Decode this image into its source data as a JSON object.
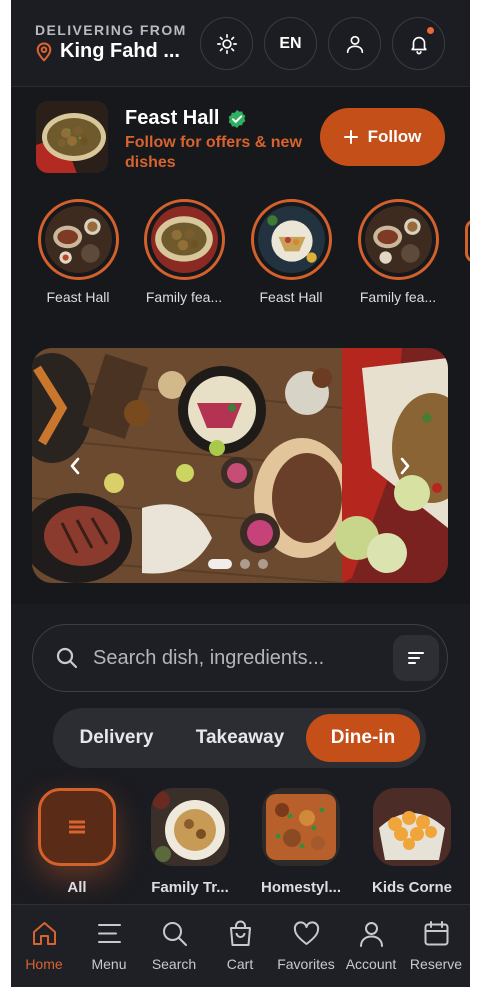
{
  "header": {
    "delivering_label": "DELIVERING FROM",
    "location": "King Fahd ...",
    "theme_icon": "sun-icon",
    "language": "EN",
    "account_icon": "user-icon",
    "notifications_icon": "bell-icon"
  },
  "store": {
    "name": "Feast Hall",
    "subtitle": "Follow for offers & new dishes",
    "follow_label": "Follow",
    "follow_icon": "plus-icon"
  },
  "stories": [
    {
      "label": "Feast Hall"
    },
    {
      "label": "Family fea..."
    },
    {
      "label": "Feast Hall"
    },
    {
      "label": "Family fea..."
    }
  ],
  "carousel": {
    "prev_icon": "chevron-left-icon",
    "next_icon": "chevron-right-icon",
    "slides": 3,
    "active_slide": 1
  },
  "search": {
    "placeholder": "Search dish, ingredients...",
    "value": ""
  },
  "modes": [
    {
      "label": "Delivery",
      "active": false
    },
    {
      "label": "Takeaway",
      "active": false
    },
    {
      "label": "Dine-in",
      "active": true
    }
  ],
  "categories": [
    {
      "label": "All",
      "active": true
    },
    {
      "label": "Family Tr..."
    },
    {
      "label": "Homestyl..."
    },
    {
      "label": "Kids Corne"
    }
  ],
  "tabs": [
    {
      "label": "Home",
      "icon": "home-icon",
      "active": true
    },
    {
      "label": "Menu",
      "icon": "menu-icon"
    },
    {
      "label": "Search",
      "icon": "search-icon"
    },
    {
      "label": "Cart",
      "icon": "cart-icon"
    },
    {
      "label": "Favorites",
      "icon": "heart-icon"
    },
    {
      "label": "Account",
      "icon": "user-icon"
    },
    {
      "label": "Reserve",
      "icon": "calendar-icon"
    }
  ],
  "colors": {
    "accent": "#c44f18",
    "accent_text": "#d8632e",
    "background": "#17181c",
    "verified": "#2fb061"
  }
}
